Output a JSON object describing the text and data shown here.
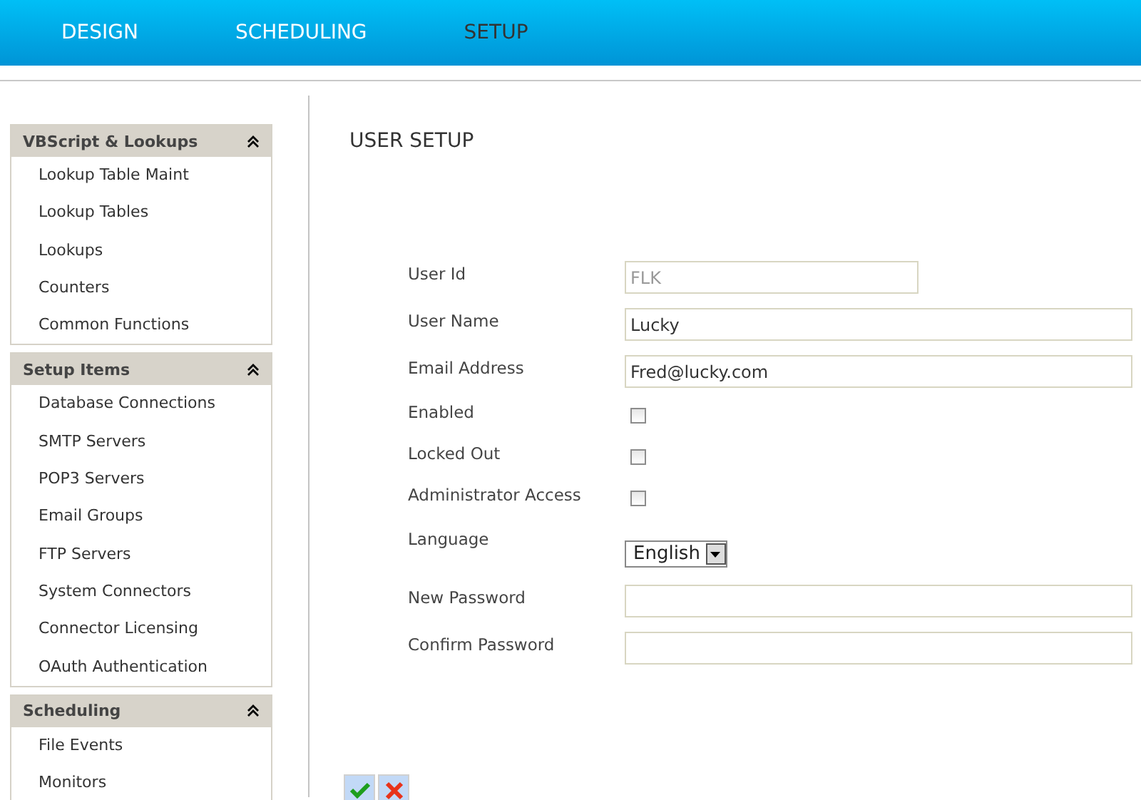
{
  "nav": [
    {
      "label": "DESIGN",
      "selected": false
    },
    {
      "label": "SCHEDULING",
      "selected": false
    },
    {
      "label": "SETUP",
      "selected": true
    }
  ],
  "sidebar": [
    {
      "title": "VBScript & Lookups",
      "expanded": true,
      "items": [
        "Lookup Table Maint",
        "Lookup Tables",
        "Lookups",
        "Counters",
        "Common Functions"
      ]
    },
    {
      "title": "Setup Items",
      "expanded": true,
      "items": [
        "Database Connections",
        "SMTP Servers",
        "POP3 Servers",
        "Email Groups",
        "FTP Servers",
        "System Connectors",
        "Connector Licensing",
        "OAuth Authentication"
      ]
    },
    {
      "title": "Scheduling",
      "expanded": true,
      "items": [
        "File Events",
        "Monitors"
      ]
    }
  ],
  "page_title": "USER SETUP",
  "fields": [
    {
      "kind": "text",
      "label": "User Id",
      "value": "FLK",
      "disabled": true
    },
    {
      "kind": "text",
      "label": "User Name",
      "value": "Lucky",
      "disabled": false
    },
    {
      "kind": "text",
      "label": "Email Address",
      "value": "Fred@lucky.com",
      "disabled": false
    },
    {
      "kind": "checkbox",
      "label": "Enabled",
      "checked": false
    },
    {
      "kind": "checkbox",
      "label": "Locked Out",
      "checked": false
    },
    {
      "kind": "checkbox",
      "label": "Administrator Access",
      "checked": false
    },
    {
      "kind": "select",
      "label": "Language",
      "value": "English"
    },
    {
      "kind": "text",
      "label": "New Password",
      "disabled": false
    },
    {
      "kind": "text",
      "label": "Confirm Password",
      "disabled": false
    }
  ],
  "actions": [
    {
      "kind": "save"
    },
    {
      "kind": "cancel"
    }
  ]
}
